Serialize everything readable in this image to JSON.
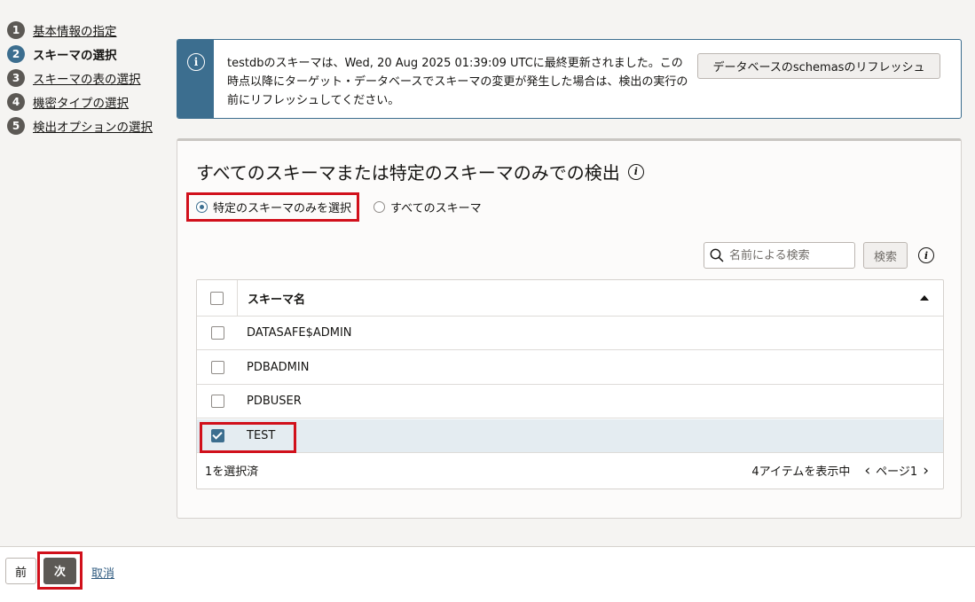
{
  "steps": [
    {
      "num": "1",
      "label": "基本情報の指定"
    },
    {
      "num": "2",
      "label": "スキーマの選択"
    },
    {
      "num": "3",
      "label": "スキーマの表の選択"
    },
    {
      "num": "4",
      "label": "機密タイプの選択"
    },
    {
      "num": "5",
      "label": "検出オプションの選択"
    }
  ],
  "banner": {
    "icon": "info-icon",
    "message": "testdbのスキーマは、Wed, 20 Aug 2025 01:39:09 UTCに最終更新されました。この時点以降にターゲット・データベースでスキーマの変更が発生した場合は、検出の実行の前にリフレッシュしてください。",
    "refresh_label": "データベースのschemasのリフレッシュ"
  },
  "panel": {
    "title": "すべてのスキーマまたは特定のスキーマのみでの検出",
    "radio_specific": "特定のスキーマのみを選択",
    "radio_all": "すべてのスキーマ",
    "search_placeholder": "名前による検索",
    "search_button": "検索"
  },
  "table": {
    "column_header": "スキーマ名",
    "rows": [
      {
        "name": "DATASAFE$ADMIN",
        "checked": false
      },
      {
        "name": "PDBADMIN",
        "checked": false
      },
      {
        "name": "PDBUSER",
        "checked": false
      },
      {
        "name": "TEST",
        "checked": true
      }
    ],
    "selected_count": "1を選択済",
    "items_shown": "4アイテムを表示中",
    "page_label": "ページ1"
  },
  "footer": {
    "prev_label": "前",
    "next_label": "次",
    "cancel_label": "取消"
  },
  "colors": {
    "accent": "#3c6e8f",
    "highlight_red": "#d1101b",
    "next_button": "#5c5955"
  }
}
